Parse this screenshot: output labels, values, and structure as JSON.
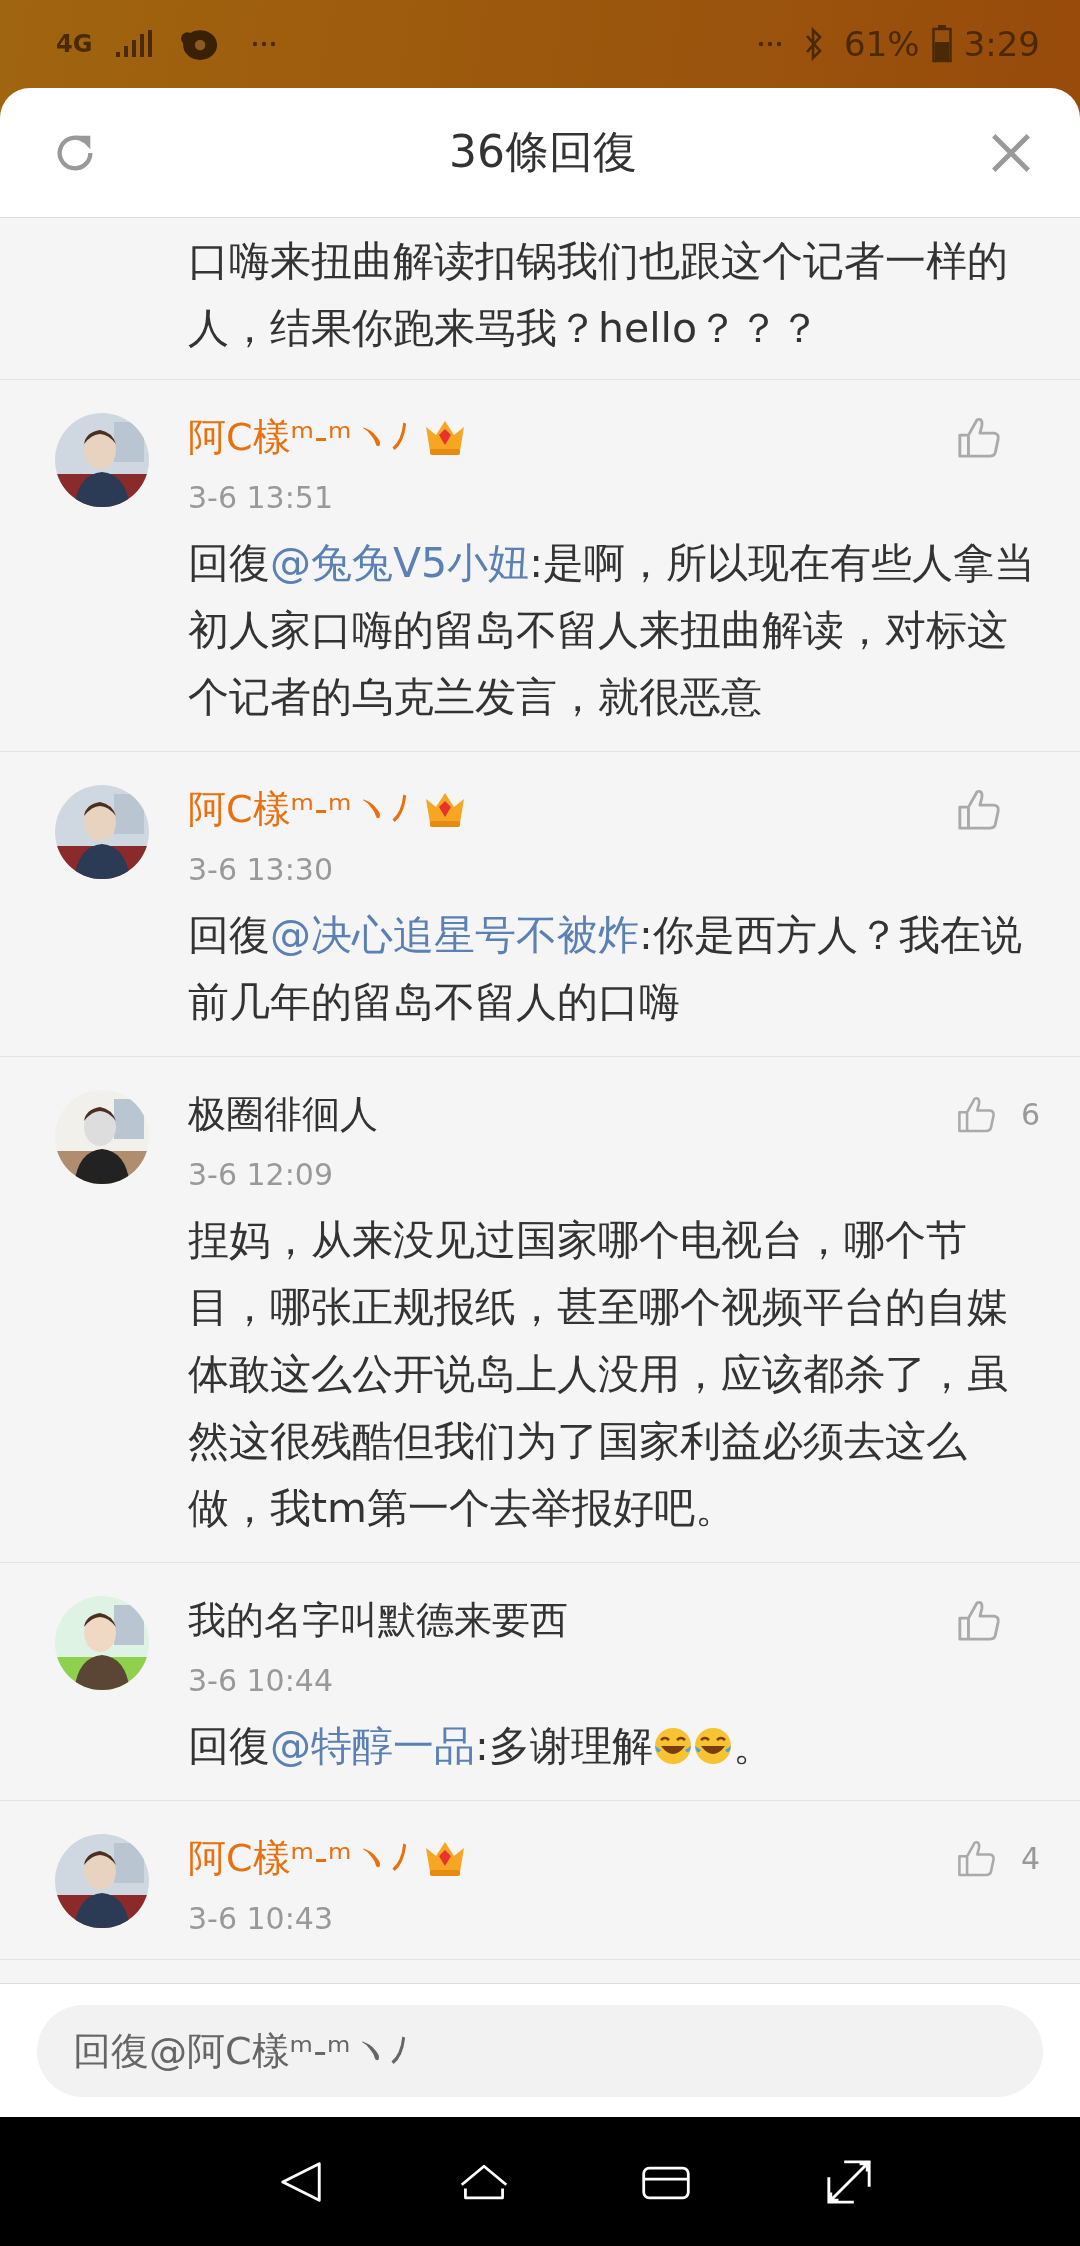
{
  "status_bar": {
    "network": "4G",
    "time": "3:29",
    "battery": "61%"
  },
  "header": {
    "title": "36條回復"
  },
  "comments": [
    {
      "kind": "continuation",
      "body": [
        {
          "kind": "text",
          "text": "口嗨来扭曲解读扣锅我们也跟这个记者一样的人，结果你跑来骂我？hello？？？"
        }
      ]
    },
    {
      "kind": "comment",
      "user": "阿C樣ᵐ-ᵐヽﾉ",
      "vip": true,
      "time": "3-6 13:51",
      "body": [
        {
          "kind": "text",
          "text": "回復"
        },
        {
          "kind": "mention",
          "text": "@兔兔V5小妞"
        },
        {
          "kind": "text",
          "text": ":是啊，所以现在有些人拿当初人家口嗨的留岛不留人来扭曲解读，对标这个记者的乌克兰发言，就很恶意"
        }
      ]
    },
    {
      "kind": "comment",
      "user": "阿C樣ᵐ-ᵐヽﾉ",
      "vip": true,
      "time": "3-6 13:30",
      "body": [
        {
          "kind": "text",
          "text": "回復"
        },
        {
          "kind": "mention",
          "text": "@决心追星号不被炸"
        },
        {
          "kind": "text",
          "text": ":你是西方人？我在说前几年的留岛不留人的口嗨"
        }
      ]
    },
    {
      "kind": "comment",
      "user": "极圈徘徊人",
      "vip": false,
      "time": "3-6 12:09",
      "likes": "6",
      "body": [
        {
          "kind": "text",
          "text": "捏妈，从来没见过国家哪个电视台，哪个节目，哪张正规报纸，甚至哪个视频平台的自媒体敢这么公开说岛上人没用，应该都杀了，虽然这很残酷但我们为了国家利益必须去这么做，我tm第一个去举报好吧。"
        }
      ]
    },
    {
      "kind": "comment",
      "user": "我的名字叫默德来要西",
      "vip": false,
      "time": "3-6 10:44",
      "body": [
        {
          "kind": "text",
          "text": "回復"
        },
        {
          "kind": "mention",
          "text": "@特醇一品"
        },
        {
          "kind": "text",
          "text": ":多谢理解"
        },
        {
          "kind": "emoji"
        },
        {
          "kind": "emoji"
        },
        {
          "kind": "text",
          "text": "。"
        }
      ]
    },
    {
      "kind": "comment",
      "user": "阿C樣ᵐ-ᵐヽﾉ",
      "vip": true,
      "time": "3-6 10:43",
      "likes": "4"
    }
  ],
  "reply_field": {
    "placeholder": "回復@阿C樣ᵐ-ᵐヽﾉ"
  }
}
